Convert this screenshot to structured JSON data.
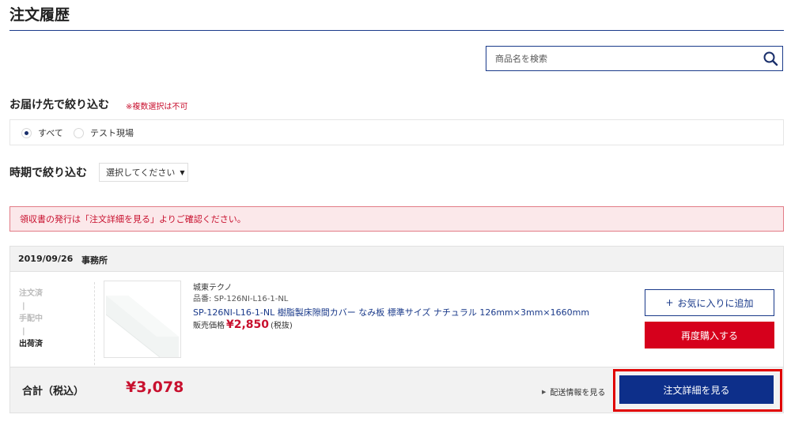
{
  "page": {
    "title": "注文履歴"
  },
  "search": {
    "placeholder": "商品名を検索",
    "value": ""
  },
  "filter_destination": {
    "title": "お届け先で絞り込む",
    "note": "※複数選択は不可",
    "options": [
      {
        "label": "すべて",
        "selected": true
      },
      {
        "label": "テスト現場",
        "selected": false
      }
    ]
  },
  "filter_period": {
    "title": "時期で絞り込む",
    "select_value": "選択してください"
  },
  "notice": {
    "text": "領収書の発行は「注文詳細を見る」よりご確認ください。"
  },
  "order": {
    "date": "2019/09/26",
    "location": "事務所",
    "status_steps": [
      "注文済",
      "|",
      "手配中",
      "|",
      "出荷済"
    ],
    "current_step": "出荷済",
    "product": {
      "maker": "城東テクノ",
      "code": "品番: SP-126NI-L16-1-NL",
      "name": "SP-126NI-L16-1-NL 樹脂製床隙間カバー なみ板 標準サイズ ナチュラル 126mm×3mm×1660mm",
      "price_label": "販売価格",
      "price": "¥2,850",
      "tax_note": "(税抜)"
    },
    "buttons": {
      "favorite": "お気に入りに追加",
      "favorite_prefix": "+",
      "rebuy": "再度購入する"
    },
    "total_label": "合計（税込）",
    "total_value": "¥3,078",
    "shipping_link": "配送情報を見る",
    "detail_button": "注文詳細を見る"
  },
  "colors": {
    "navy": "#1a3a8a",
    "detail_blue": "#0d2f8a",
    "red": "#c8102e",
    "rebuy_red": "#d6001c",
    "highlight_red": "#e00000",
    "alert_bg": "#fbe8ea"
  },
  "icons": {
    "search": "magnifier",
    "triangle": "play-triangle",
    "dropdown": "caret-down"
  }
}
